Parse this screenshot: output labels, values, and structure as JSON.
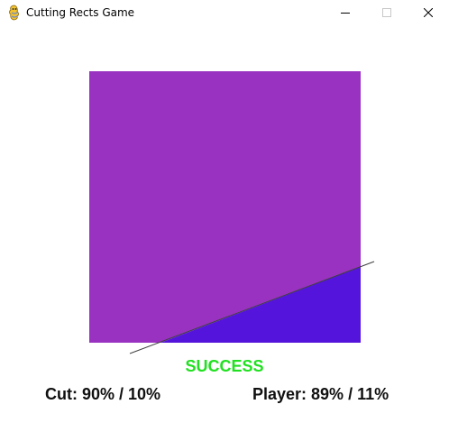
{
  "window": {
    "title": "Cutting Rects Game",
    "controls": [
      "minimize",
      "maximize",
      "close"
    ]
  },
  "game": {
    "colors": {
      "main_piece": "#9932c0",
      "cut_piece": "#5514dc",
      "cut_line": "#404040",
      "status": "#20e020",
      "text": "#101010"
    },
    "status_text": "SUCCESS",
    "cut_text": "Cut: 90% / 10%",
    "player_text": "Player: 89% / 11%"
  }
}
